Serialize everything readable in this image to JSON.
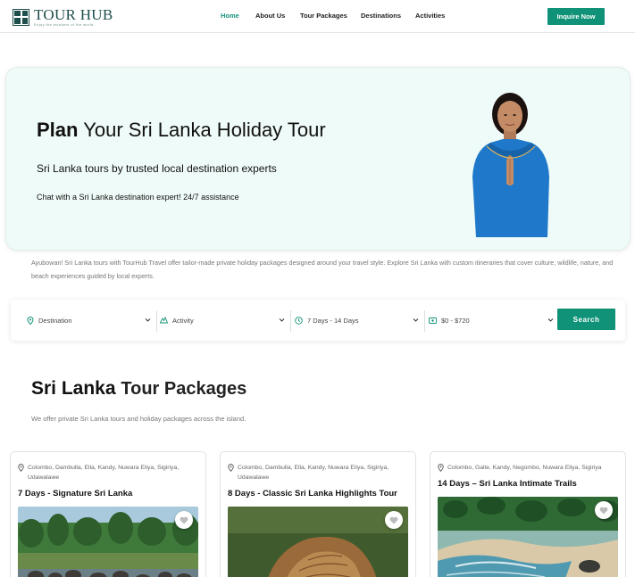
{
  "brand": {
    "name": "TOUR HUB",
    "tagline": "Enjoy the wonders of the world"
  },
  "nav": {
    "items": [
      {
        "label": "Home",
        "active": true
      },
      {
        "label": "About Us",
        "active": false
      },
      {
        "label": "Tour Packages",
        "active": false
      },
      {
        "label": "Destinations",
        "active": false
      },
      {
        "label": "Activities",
        "active": false
      }
    ],
    "cta_label": "Inquire Now"
  },
  "hero": {
    "title_bold": "Plan",
    "title_rest": "Your Sri Lanka Holiday Tour",
    "subtitle": "Sri Lanka tours by trusted local destination experts",
    "chat_line": "Chat with a Sri Lanka destination expert! 24/7 assistance"
  },
  "intro_text": "Ayubowan! Sri Lanka tours with TourHub Travel offer tailor-made private holiday packages designed around your travel style. Explore Sri Lanka with custom itineraries that cover culture, wildlife, nature, and beach experiences guided by local experts.",
  "search": {
    "destination": "Destination",
    "activity": "Activity",
    "duration": "7 Days - 14 Days",
    "budget": "$0 - $720",
    "button_label": "Search"
  },
  "packages_section": {
    "title_bold": "Sri Lanka",
    "title_rest": "Tour Packages",
    "subtitle": "We offer private Sri Lanka tours and holiday packages across the island."
  },
  "packages": [
    {
      "locations": "Colombo, Dambulla, Ella, Kandy, Nuwara Eliya, Sigiriya, Udawalawe",
      "title": "7 Days - Signature Sri Lanka"
    },
    {
      "locations": "Colombo, Dambulla, Ella, Kandy, Nuwara Eliya, Sigiriya, Udawalawe",
      "title": "8 Days - Classic Sri Lanka Highlights Tour"
    },
    {
      "locations": "Colombo, Galle, Kandy, Negombo, Nuwara Eliya, Sigiriya",
      "title": "14 Days – Sri Lanka Intimate Trails"
    }
  ],
  "colors": {
    "accent": "#0f9277",
    "hero_bg": "#effbf8",
    "brand": "#1d4e4b"
  },
  "icons": [
    "location-pin-icon",
    "activity-icon",
    "clock-icon",
    "money-icon",
    "chevron-down-icon",
    "heart-icon"
  ]
}
